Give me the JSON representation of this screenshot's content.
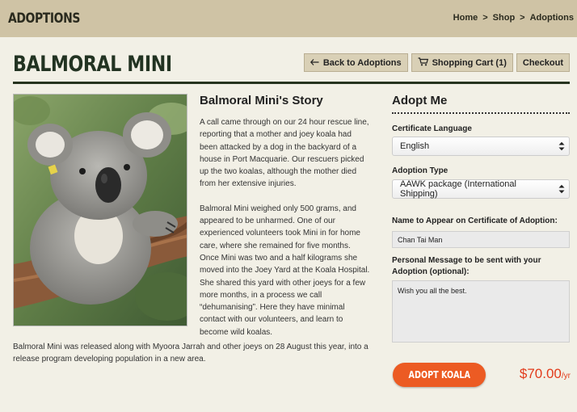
{
  "header": {
    "section_title": "ADOPTIONS",
    "breadcrumb": [
      "Home",
      "Shop",
      "Adoptions"
    ],
    "separator": ">"
  },
  "page": {
    "title": "BALMORAL MINI",
    "buttons": {
      "back_label": "Back to Adoptions",
      "back_icon": "left-arrow-icon",
      "cart_label": "Shopping Cart (1)",
      "cart_icon": "shopping-cart-icon",
      "checkout_label": "Checkout"
    }
  },
  "story": {
    "title": "Balmoral Mini's Story",
    "paragraphs": [
      "A call came through on our 24 hour rescue line, reporting that a mother and joey koala had been attacked by a dog in the backyard of a house in Port Macquarie. Our rescuers picked up the two koalas, although the mother died from her extensive injuries.",
      "Balmoral Mini weighed only 500 grams, and appeared to be unharmed. One of our experienced volunteers took Mini in for home care, where she remained for five months. Once Mini was two and a half kilograms she moved into the Joey Yard at the Koala Hospital. She shared this yard with other joeys for a few more months, in a process we call “dehumanising”. Here they have minimal contact with our volunteers, and learn to become wild koalas."
    ],
    "release": "Balmoral Mini was released along with Myoora Jarrah and other joeys on 28 August this year, into a release program developing population in a new area."
  },
  "adopt": {
    "title": "Adopt Me",
    "certificate_language": {
      "label": "Certificate Language",
      "value": "English"
    },
    "adoption_type": {
      "label": "Adoption Type",
      "value": "AAWK package (International Shipping)"
    },
    "name_on_certificate": {
      "label": "Name to Appear on Certificate of Adoption:",
      "value": "Chan Tai Man"
    },
    "personal_message": {
      "label_line1": "Personal Message to be sent with your",
      "label_line2": "Adoption (optional):",
      "value": "Wish you all the best."
    },
    "button_label": "ADOPT KOALA",
    "price": "$70.00",
    "price_unit": "/yr"
  },
  "colors": {
    "header_bg": "#cfc3a5",
    "page_bg": "#f2f0e6",
    "accent_orange": "#ec5b23",
    "price_red": "#e23b1b",
    "dark_green": "#223322"
  }
}
